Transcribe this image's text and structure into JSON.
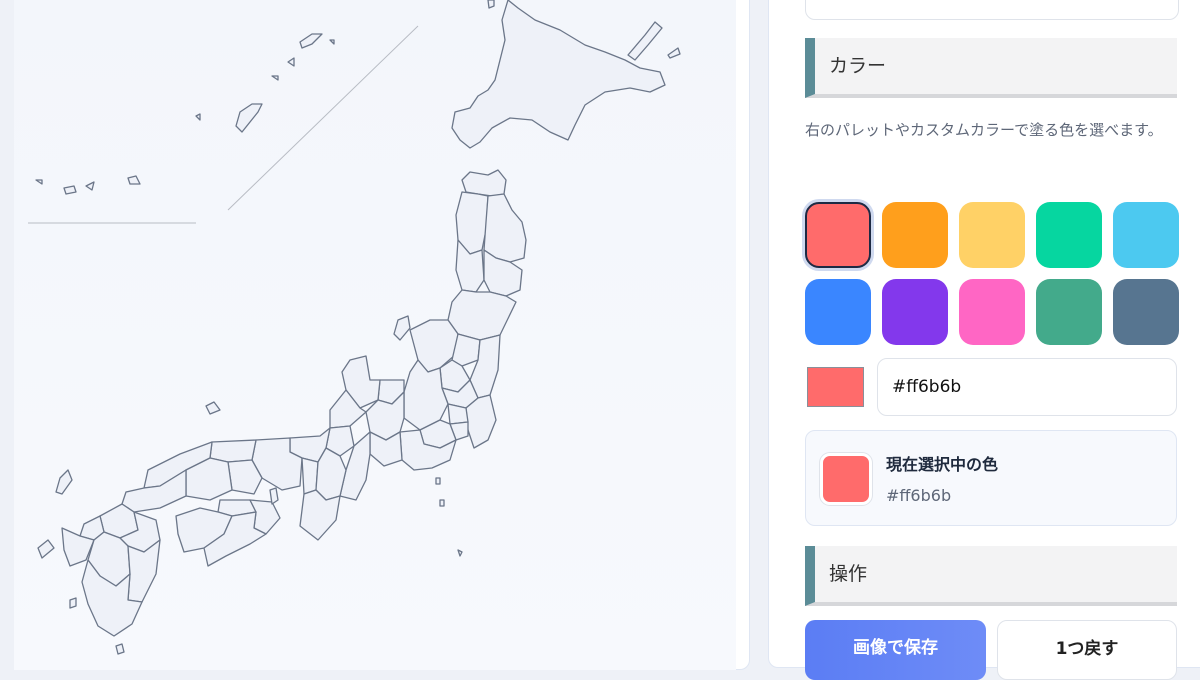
{
  "color_section": {
    "title": "カラー",
    "hint": "右のパレットやカスタムカラーで塗る色を選べます。",
    "palette": [
      {
        "name": "red",
        "hex": "#ff6b6b",
        "selected": true
      },
      {
        "name": "orange",
        "hex": "#ff9f1c"
      },
      {
        "name": "yellow",
        "hex": "#ffd166"
      },
      {
        "name": "teal",
        "hex": "#06d6a0"
      },
      {
        "name": "sky",
        "hex": "#4cc9f0"
      },
      {
        "name": "blue",
        "hex": "#3a86ff"
      },
      {
        "name": "purple",
        "hex": "#8338ec"
      },
      {
        "name": "pink",
        "hex": "#ff66c4"
      },
      {
        "name": "green",
        "hex": "#43aa8b"
      },
      {
        "name": "slate",
        "hex": "#577590"
      }
    ],
    "custom_hex_value": "#ff6b6b",
    "custom_preview_color": "#ff6b6b",
    "current": {
      "title": "現在選択中の色",
      "hex": "#ff6b6b",
      "color": "#ff6b6b"
    }
  },
  "operations_section": {
    "title": "操作",
    "save_label": "画像で保存",
    "undo_label": "1つ戻す"
  },
  "map": {
    "fill_color": "#eef1f8",
    "stroke_color": "#6b7689"
  }
}
